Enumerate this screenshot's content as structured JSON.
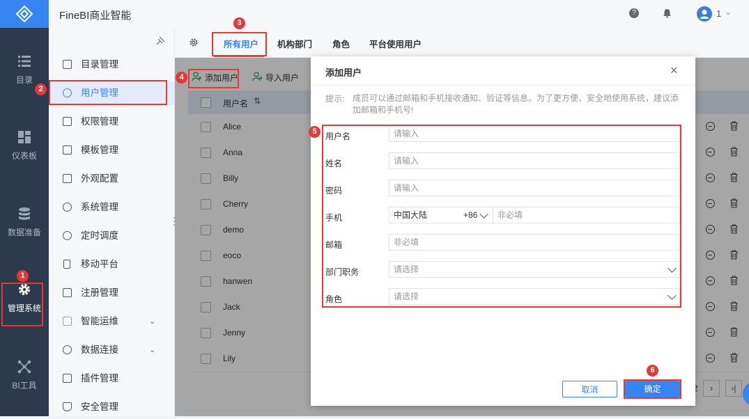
{
  "app": {
    "title": "FineBI商业智能"
  },
  "topbar": {
    "user_num": "1"
  },
  "leftnav": {
    "items": [
      {
        "label": "目录",
        "icon": "list-icon"
      },
      {
        "label": "仪表板",
        "icon": "dashboard-icon"
      },
      {
        "label": "数据准备",
        "icon": "database-icon"
      },
      {
        "label": "管理系统",
        "icon": "gear-icon"
      },
      {
        "label": "BI工具",
        "icon": "network-icon"
      }
    ]
  },
  "sidebar": {
    "items": [
      {
        "label": "目录管理"
      },
      {
        "label": "用户管理"
      },
      {
        "label": "权限管理"
      },
      {
        "label": "模板管理"
      },
      {
        "label": "外观配置"
      },
      {
        "label": "系统管理"
      },
      {
        "label": "定时调度"
      },
      {
        "label": "移动平台"
      },
      {
        "label": "注册管理"
      },
      {
        "label": "智能运维"
      },
      {
        "label": "数据连接"
      },
      {
        "label": "插件管理"
      },
      {
        "label": "安全管理"
      }
    ]
  },
  "tabs": [
    {
      "label": "所有用户"
    },
    {
      "label": "机构部门"
    },
    {
      "label": "角色"
    },
    {
      "label": "平台使用用户"
    }
  ],
  "toolbar": {
    "add_user": "添加用户",
    "import_user": "导入用户"
  },
  "table": {
    "header": "用户名",
    "rows": [
      "Alice",
      "Anna",
      "Billy",
      "Cherry",
      "demo",
      "eoco",
      "hanwen",
      "Jack",
      "Jenny",
      "Lily"
    ]
  },
  "pagination": {
    "page": "2"
  },
  "steps": [
    "1",
    "2",
    "3",
    "4",
    "5",
    "6"
  ],
  "dialog": {
    "title": "添加用户",
    "hint_label": "提示:",
    "hint": "成员可以通过邮箱和手机接收通知、验证等信息。为了更方便、安全地使用系统，建议添加邮箱和手机号!",
    "fields": {
      "username": {
        "label": "用户名",
        "placeholder": "请输入"
      },
      "realname": {
        "label": "姓名",
        "placeholder": "请输入"
      },
      "password": {
        "label": "密码",
        "placeholder": "请输入"
      },
      "phone": {
        "label": "手机",
        "region": "中国大陆",
        "code": "+86",
        "placeholder": "非必填"
      },
      "email": {
        "label": "邮箱",
        "placeholder": "非必填"
      },
      "department": {
        "label": "部门职务",
        "placeholder": "请选择"
      },
      "role": {
        "label": "角色",
        "placeholder": "请选择"
      }
    },
    "cancel": "取消",
    "confirm": "确定"
  },
  "colors": {
    "accent": "#3685f2",
    "highlight": "#e53935",
    "nav_bg": "#2c3a4e"
  }
}
